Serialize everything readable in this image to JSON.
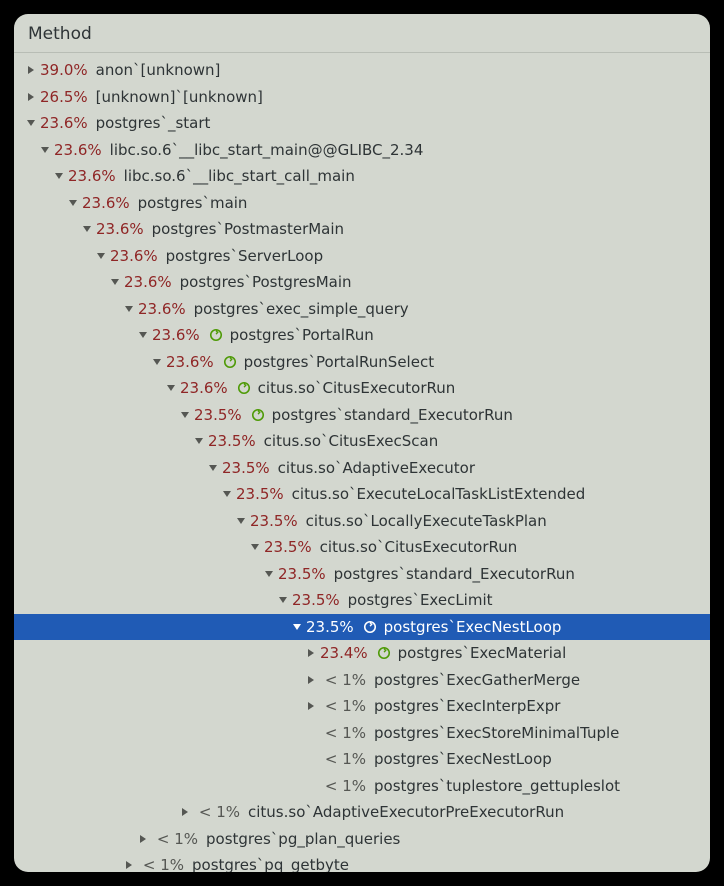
{
  "header": {
    "title": "Method"
  },
  "indentStep": 14,
  "baseIndent": 10,
  "rows": [
    {
      "depth": 0,
      "arrow": "right",
      "pct": "39.0%",
      "low": false,
      "icon": false,
      "label": "anon`[unknown]",
      "selected": false
    },
    {
      "depth": 0,
      "arrow": "right",
      "pct": "26.5%",
      "low": false,
      "icon": false,
      "label": "[unknown]`[unknown]",
      "selected": false
    },
    {
      "depth": 0,
      "arrow": "down",
      "pct": "23.6%",
      "low": false,
      "icon": false,
      "label": "postgres`_start",
      "selected": false
    },
    {
      "depth": 1,
      "arrow": "down",
      "pct": "23.6%",
      "low": false,
      "icon": false,
      "label": "libc.so.6`__libc_start_main@@GLIBC_2.34",
      "selected": false
    },
    {
      "depth": 2,
      "arrow": "down",
      "pct": "23.6%",
      "low": false,
      "icon": false,
      "label": "libc.so.6`__libc_start_call_main",
      "selected": false
    },
    {
      "depth": 3,
      "arrow": "down",
      "pct": "23.6%",
      "low": false,
      "icon": false,
      "label": "postgres`main",
      "selected": false
    },
    {
      "depth": 4,
      "arrow": "down",
      "pct": "23.6%",
      "low": false,
      "icon": false,
      "label": "postgres`PostmasterMain",
      "selected": false
    },
    {
      "depth": 5,
      "arrow": "down",
      "pct": "23.6%",
      "low": false,
      "icon": false,
      "label": "postgres`ServerLoop",
      "selected": false
    },
    {
      "depth": 6,
      "arrow": "down",
      "pct": "23.6%",
      "low": false,
      "icon": false,
      "label": "postgres`PostgresMain",
      "selected": false
    },
    {
      "depth": 7,
      "arrow": "down",
      "pct": "23.6%",
      "low": false,
      "icon": false,
      "label": "postgres`exec_simple_query",
      "selected": false
    },
    {
      "depth": 8,
      "arrow": "down",
      "pct": "23.6%",
      "low": false,
      "icon": true,
      "label": "postgres`PortalRun",
      "selected": false
    },
    {
      "depth": 9,
      "arrow": "down",
      "pct": "23.6%",
      "low": false,
      "icon": true,
      "label": "postgres`PortalRunSelect",
      "selected": false
    },
    {
      "depth": 10,
      "arrow": "down",
      "pct": "23.6%",
      "low": false,
      "icon": true,
      "label": "citus.so`CitusExecutorRun",
      "selected": false
    },
    {
      "depth": 11,
      "arrow": "down",
      "pct": "23.5%",
      "low": false,
      "icon": true,
      "label": "postgres`standard_ExecutorRun",
      "selected": false
    },
    {
      "depth": 12,
      "arrow": "down",
      "pct": "23.5%",
      "low": false,
      "icon": false,
      "label": "citus.so`CitusExecScan",
      "selected": false
    },
    {
      "depth": 13,
      "arrow": "down",
      "pct": "23.5%",
      "low": false,
      "icon": false,
      "label": "citus.so`AdaptiveExecutor",
      "selected": false
    },
    {
      "depth": 14,
      "arrow": "down",
      "pct": "23.5%",
      "low": false,
      "icon": false,
      "label": "citus.so`ExecuteLocalTaskListExtended",
      "selected": false
    },
    {
      "depth": 15,
      "arrow": "down",
      "pct": "23.5%",
      "low": false,
      "icon": false,
      "label": "citus.so`LocallyExecuteTaskPlan",
      "selected": false
    },
    {
      "depth": 16,
      "arrow": "down",
      "pct": "23.5%",
      "low": false,
      "icon": false,
      "label": "citus.so`CitusExecutorRun",
      "selected": false
    },
    {
      "depth": 17,
      "arrow": "down",
      "pct": "23.5%",
      "low": false,
      "icon": false,
      "label": "postgres`standard_ExecutorRun",
      "selected": false
    },
    {
      "depth": 18,
      "arrow": "down",
      "pct": "23.5%",
      "low": false,
      "icon": false,
      "label": "postgres`ExecLimit",
      "selected": false
    },
    {
      "depth": 19,
      "arrow": "down",
      "pct": "23.5%",
      "low": false,
      "icon": true,
      "label": "postgres`ExecNestLoop",
      "selected": true
    },
    {
      "depth": 20,
      "arrow": "right",
      "pct": "23.4%",
      "low": false,
      "icon": true,
      "label": "postgres`ExecMaterial",
      "selected": false
    },
    {
      "depth": 20,
      "arrow": "right",
      "pct": "< 1%",
      "low": true,
      "icon": false,
      "label": "postgres`ExecGatherMerge",
      "selected": false
    },
    {
      "depth": 20,
      "arrow": "right",
      "pct": "< 1%",
      "low": true,
      "icon": false,
      "label": "postgres`ExecInterpExpr",
      "selected": false
    },
    {
      "depth": 20,
      "arrow": "none",
      "pct": "< 1%",
      "low": true,
      "icon": false,
      "label": "postgres`ExecStoreMinimalTuple",
      "selected": false
    },
    {
      "depth": 20,
      "arrow": "none",
      "pct": "< 1%",
      "low": true,
      "icon": false,
      "label": "postgres`ExecNestLoop",
      "selected": false
    },
    {
      "depth": 20,
      "arrow": "none",
      "pct": "< 1%",
      "low": true,
      "icon": false,
      "label": "postgres`tuplestore_gettupleslot",
      "selected": false
    },
    {
      "depth": 11,
      "arrow": "right",
      "pct": "< 1%",
      "low": true,
      "icon": false,
      "label": "citus.so`AdaptiveExecutorPreExecutorRun",
      "selected": false
    },
    {
      "depth": 8,
      "arrow": "right",
      "pct": "< 1%",
      "low": true,
      "icon": false,
      "label": "postgres`pg_plan_queries",
      "selected": false
    },
    {
      "depth": 7,
      "arrow": "right",
      "pct": "< 1%",
      "low": true,
      "icon": false,
      "label": "postgres`pq_getbyte",
      "selected": false
    }
  ]
}
